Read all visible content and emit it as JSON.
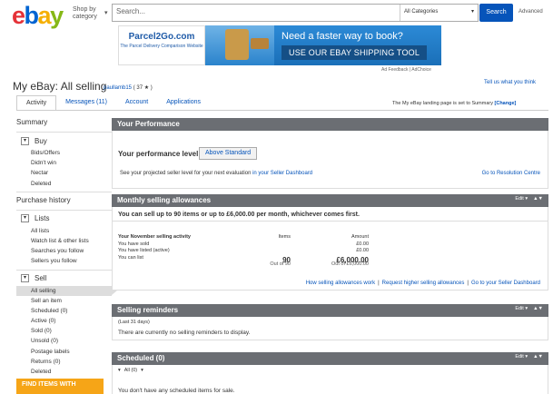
{
  "header": {
    "logo_letters": [
      "e",
      "b",
      "a",
      "y"
    ],
    "shop_by": "Shop by category",
    "search_placeholder": "Search...",
    "category": "All Categories",
    "search_button": "Search",
    "advanced": "Advanced"
  },
  "banner": {
    "brand": "Parcel2Go.com",
    "sub": "The Parcel Delivery Comparison Website",
    "headline": "Need a faster way to book?",
    "cta": "USE OUR EBAY SHIPPING TOOL",
    "ad_feedback": "Ad Feedback | AdChoice"
  },
  "page": {
    "title": "My eBay: All selling",
    "username": "paullamb15",
    "feedback": "( 37 ★ )",
    "tell_us": "Tell us what you think",
    "landing_note": "The My eBay landing page is set to Summary",
    "landing_change": "[Change]"
  },
  "tabs": [
    "Activity",
    "Messages (11)",
    "Account",
    "Applications"
  ],
  "sidebar": {
    "summary": "Summary",
    "buy": {
      "label": "Buy",
      "items": [
        "Bids/Offers",
        "Didn't win",
        "Nectar",
        "Deleted"
      ]
    },
    "purchase_history": "Purchase history",
    "lists": {
      "label": "Lists",
      "items": [
        "All lists",
        "Watch list & other lists",
        "Searches you follow",
        "Sellers you follow"
      ]
    },
    "sell": {
      "label": "Sell",
      "items": [
        "All selling",
        "Sell an item",
        "Scheduled (0)",
        "Active (0)",
        "Sold (0)",
        "Unsold (0)",
        "Postage labels",
        "Returns (0)",
        "Deleted"
      ]
    },
    "find_items": "FIND ITEMS WITH"
  },
  "performance": {
    "title": "Your Performance",
    "level_label": "Your performance level",
    "level_value": "Above Standard",
    "note_prefix": "See your projected seller level for your next evaluation",
    "note_link": "in your Seller Dashboard",
    "resolution": "Go to Resolution Centre"
  },
  "allowances": {
    "title": "Monthly selling allowances",
    "edit": "Edit ▾",
    "summary": "You can sell up to 90 items or up to £6,000.00 per month, whichever comes first.",
    "col_activity": "Your November selling activity",
    "col_items": "Items",
    "col_amount": "Amount",
    "rows": [
      {
        "label": "You have sold",
        "items": "",
        "amount": "£0.00"
      },
      {
        "label": "You have listed (active)",
        "items": "",
        "amount": "£0.00"
      }
    ],
    "can_list_label": "You can list",
    "can_list_items": "90",
    "can_list_amount": "£6,000.00",
    "out_of_items": "Out of 90",
    "out_of_amount": "Out of £6,000.00",
    "links": [
      "How selling allowances work",
      "Request higher selling allowances",
      "Go to your Seller Dashboard"
    ]
  },
  "reminders": {
    "title": "Selling reminders",
    "edit": "Edit ▾",
    "period": "(Last 31 days)",
    "text": "There are currently no selling reminders to display."
  },
  "scheduled": {
    "title": "Scheduled (0)",
    "edit": "Edit ▾",
    "filter": "All (0)",
    "text": "You don't have any scheduled items for sale."
  }
}
